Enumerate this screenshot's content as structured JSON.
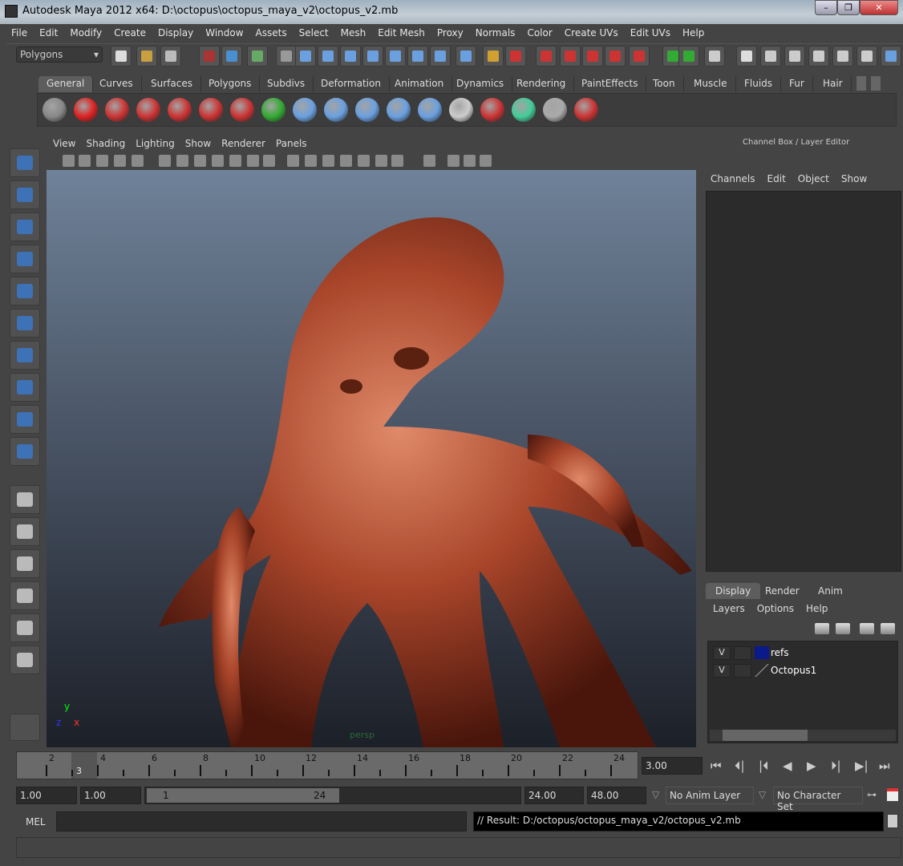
{
  "window": {
    "title": "Autodesk Maya 2012 x64: D:\\octopus\\octopus_maya_v2\\octopus_v2.mb",
    "min": "–",
    "max": "❐",
    "close": "✕"
  },
  "menubar": [
    "File",
    "Edit",
    "Modify",
    "Create",
    "Display",
    "Window",
    "Assets",
    "Select",
    "Mesh",
    "Edit Mesh",
    "Proxy",
    "Normals",
    "Color",
    "Create UVs",
    "Edit UVs",
    "Help"
  ],
  "toolbar": {
    "menuset": "Polygons"
  },
  "shelf": {
    "tabs": [
      "General",
      "Curves",
      "Surfaces",
      "Polygons",
      "Subdivs",
      "Deformation",
      "Animation",
      "Dynamics",
      "Rendering",
      "PaintEffects",
      "Toon",
      "Muscle",
      "Fluids",
      "Fur",
      "Hair"
    ],
    "active": "General"
  },
  "panel": {
    "menu": [
      "View",
      "Shading",
      "Lighting",
      "Show",
      "Renderer",
      "Panels"
    ],
    "camera": "persp",
    "axis": {
      "x": "x",
      "y": "y",
      "z": "z"
    }
  },
  "channelbox": {
    "title": "Channel Box / Layer Editor",
    "menu": [
      "Channels",
      "Edit",
      "Object",
      "Show"
    ]
  },
  "layereditor": {
    "tabs": [
      "Display",
      "Render",
      "Anim"
    ],
    "active": "Display",
    "menu": [
      "Layers",
      "Options",
      "Help"
    ],
    "layers": [
      {
        "visible": "V",
        "name": "refs",
        "color": "#0a1a8a"
      },
      {
        "visible": "V",
        "name": "Octopus1",
        "color": ""
      }
    ]
  },
  "timeline": {
    "ticks": [
      "2",
      "4",
      "6",
      "8",
      "10",
      "12",
      "14",
      "16",
      "18",
      "20",
      "22",
      "24"
    ],
    "current_marker": "3",
    "current_time": "3.00"
  },
  "range": {
    "anim_start": "1.00",
    "play_start": "1.00",
    "slider_start": "1",
    "slider_end": "24",
    "play_end": "24.00",
    "anim_end": "48.00",
    "anim_layer": "No Anim Layer",
    "character_set": "No Character Set"
  },
  "command": {
    "label": "MEL",
    "input": "",
    "result": "// Result: D:/octopus/octopus_maya_v2/octopus_v2.mb"
  },
  "colors": {
    "bg": "#444444",
    "viewport_top": "#6f8299",
    "viewport_bottom": "#1c2028",
    "octopus": "#a0452a"
  }
}
